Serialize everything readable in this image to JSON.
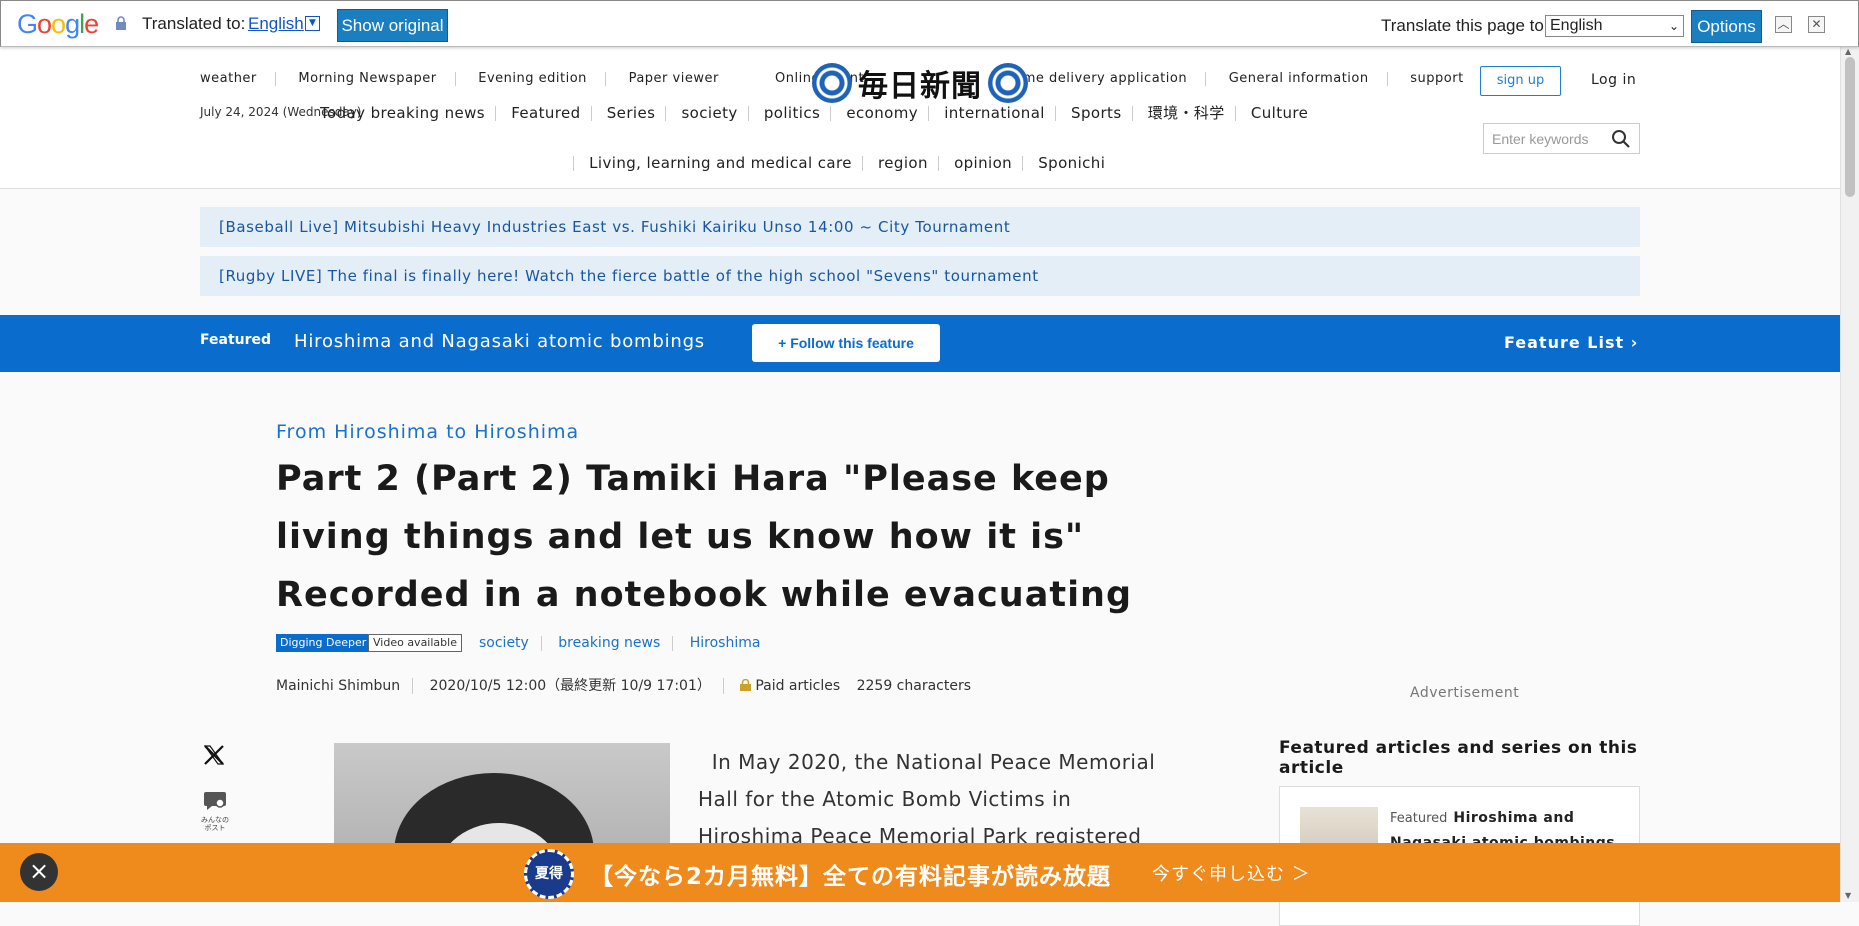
{
  "translate_bar": {
    "logo": "Google",
    "translated_to_label": "Translated to:",
    "language": "English",
    "show_original": "Show original",
    "translate_page_label": "Translate this page to",
    "page_language": "English",
    "options": "Options"
  },
  "header": {
    "top_nav": [
      "weather",
      "Morning Newspaper",
      "Evening edition",
      "Paper viewer",
      "Online event",
      "Home delivery application",
      "General information",
      "support"
    ],
    "logo_text": "毎日新聞",
    "signup": "sign up",
    "login": "Log in",
    "date": "July 24, 2024 (Wednesday)",
    "cat_nav_row1": [
      "Today",
      "breaking news",
      "Featured",
      "Series",
      "society",
      "politics",
      "economy",
      "international",
      "Sports",
      "環境・科学",
      "Culture"
    ],
    "cat_nav_row2": [
      "Living, learning and medical care",
      "region",
      "opinion",
      "Sponichi"
    ],
    "search_placeholder": "Enter keywords"
  },
  "live_banners": [
    "[Baseball Live] Mitsubishi Heavy Industries East vs. Fushiki Kairiku Unso 14:00 ~ City Tournament",
    "[Rugby LIVE] The final is finally here! Watch the fierce battle of the high school \"Sevens\" tournament"
  ],
  "feature_bar": {
    "label": "Featured",
    "title": "Hiroshima and Nagasaki atomic bombings",
    "follow": "Follow this feature",
    "list": "Feature List"
  },
  "article": {
    "kicker": "From Hiroshima to Hiroshima",
    "title": "Part 2 (Part 2) Tamiki Hara \"Please keep living things and let us know how it is\" Recorded in a notebook while evacuating",
    "badges": [
      "Digging Deeper",
      "Video available"
    ],
    "tags": [
      "society",
      "breaking news",
      "Hiroshima"
    ],
    "source": "Mainichi Shimbun",
    "datetime": "2020/10/5 12:00（最終更新 10/9 17:01）",
    "paid": "Paid articles",
    "length": "2259 characters",
    "body": "In May 2020, the National Peace Memorial Hall for the Atomic Bomb Victims in Hiroshima Peace Memorial Park registered",
    "share_x_icon": "x-icon",
    "post_icon_label": "みんなのポスト"
  },
  "sidebar": {
    "advertisement": "Advertisement",
    "heading": "Featured articles and series on this article",
    "card_kicker": "Featured",
    "card_title": "Hiroshima and Nagasaki atomic bombings"
  },
  "promo": {
    "badge": "夏得",
    "text": "【今なら2カ月無料】全ての有料記事が読み放題",
    "cta": "今すぐ申し込む ＞"
  },
  "colors": {
    "brand_blue": "#0a6ccc",
    "promo_orange": "#ef8a1d",
    "live_bg": "#e3eef6"
  }
}
